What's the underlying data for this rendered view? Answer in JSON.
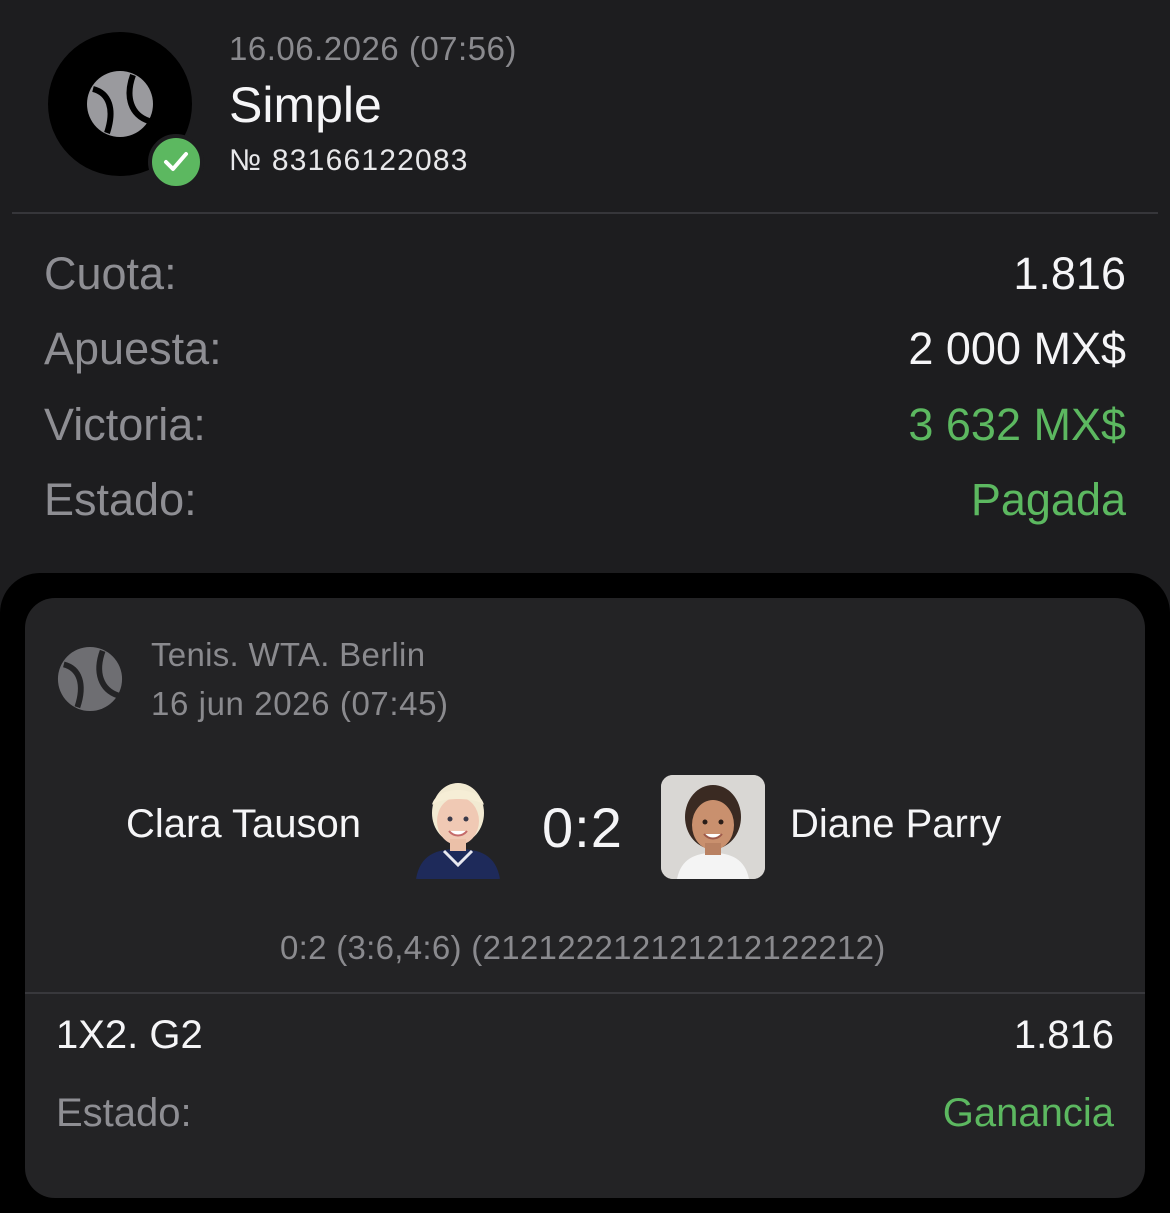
{
  "bet": {
    "date": "16.06.2026 (07:56)",
    "type": "Simple",
    "number": "№ 83166122083",
    "sport_icon": "tennis-ball-icon",
    "status_icon": "check-icon"
  },
  "summary": {
    "odds_label": "Cuota:",
    "odds_value": "1.816",
    "stake_label": "Apuesta:",
    "stake_value": "2 000 MX$",
    "win_label": "Victoria:",
    "win_value": "3 632 MX$",
    "status_label": "Estado:",
    "status_value": "Pagada"
  },
  "event": {
    "league": "Tenis. WTA. Berlin",
    "datetime": "16 jun 2026 (07:45)",
    "team1": "Clara Tauson",
    "team2": "Diane Parry",
    "score": "0:2",
    "score_detail": "0:2 (3:6,4:6) (212122212121212122212)"
  },
  "market": {
    "name": "1X2. G2",
    "odds": "1.816",
    "status_label": "Estado:",
    "status_value": "Ganancia"
  },
  "colors": {
    "background": "#1d1d1f",
    "card": "#232325",
    "accent_green": "#5cb860",
    "muted_text": "#8e8e93"
  }
}
